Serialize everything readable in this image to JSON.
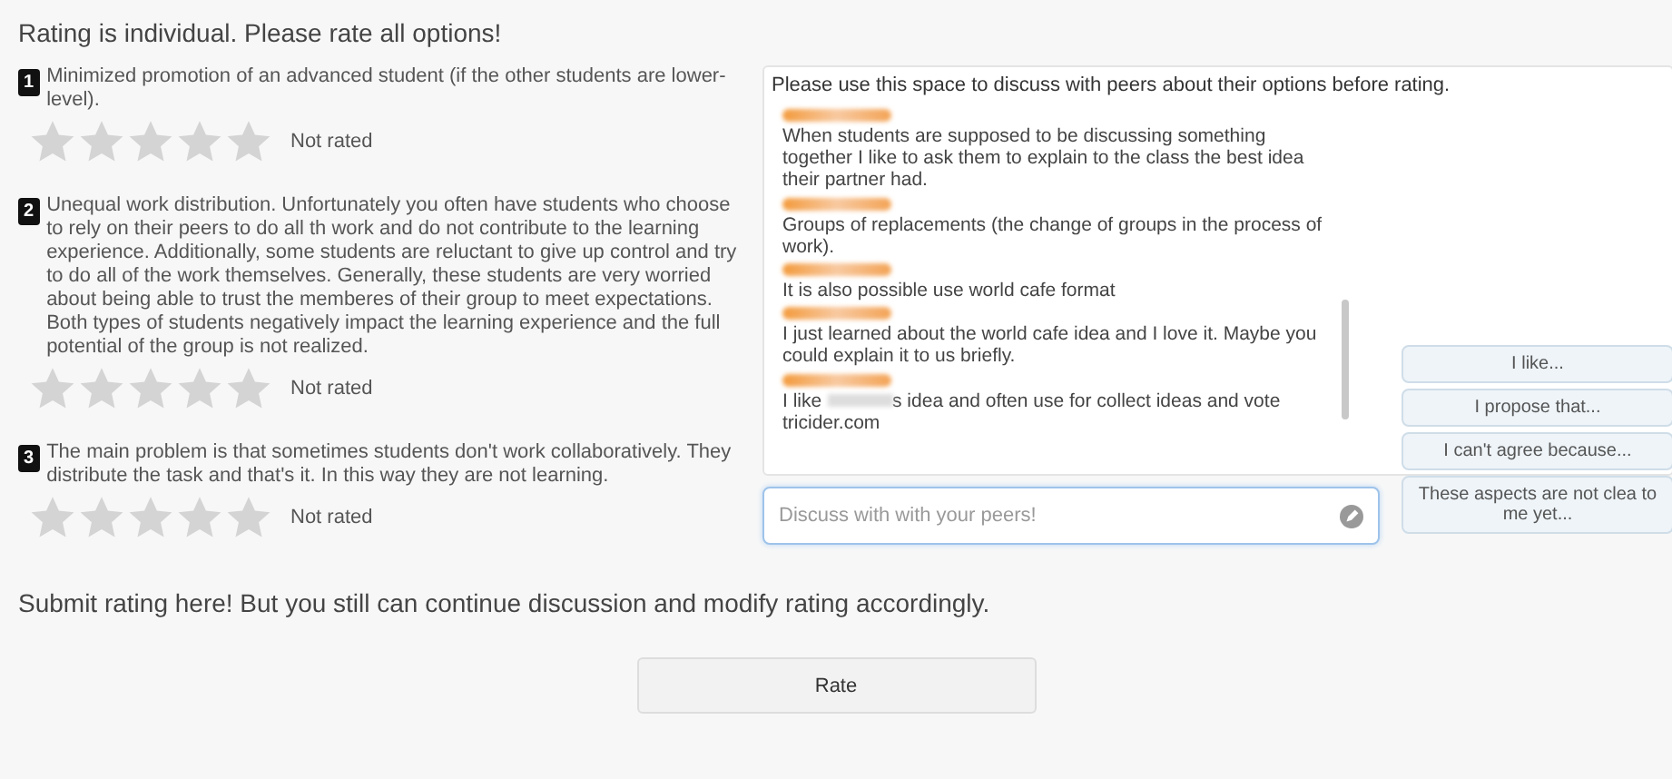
{
  "heading": "Rating is individual. Please rate all options!",
  "options": [
    {
      "number": "1",
      "text": "Minimized promotion of an advanced student (if the other students are lower-level).",
      "stars": 0,
      "status": "Not rated"
    },
    {
      "number": "2",
      "text": "Unequal work distribution. Unfortunately you often have students who choose to rely on their peers to do all th work and do not contribute to the learning experience. Additionally, some students are reluctant to give up control and try to do all of the work themselves. Generally, these students are very worried about being able to trust the memberes of their group to meet expectations. Both types of students negatively impact the learning experience and the full potential of the group is not realized.",
      "stars": 0,
      "status": "Not rated"
    },
    {
      "number": "3",
      "text": "The main problem is that sometimes students don't work collaboratively. They distribute the task and that's it. In this way they are not learning.",
      "stars": 0,
      "status": "Not rated"
    }
  ],
  "discussion": {
    "header": "Please use this space to discuss with peers about their options before rating.",
    "messages": [
      {
        "text": "When students are supposed to be discussing something together I like to ask them to explain to the class the best idea their partner had."
      },
      {
        "text": "Groups of replacements (the change of groups in the process of work)."
      },
      {
        "text": "It is also possible use world cafe format"
      },
      {
        "text": "I just learned about the world cafe idea and I love it. Maybe you could explain it to us briefly."
      },
      {
        "text": "I like",
        "text_after": "s idea and often use for collect ideas and vote tricider.com"
      }
    ],
    "input": {
      "placeholder": "Discuss with with your peers!"
    },
    "phrases": [
      "I like...",
      "I propose that...",
      "I can't agree because...",
      "These aspects are not clea to me yet..."
    ]
  },
  "submit_note": "Submit rating here! But you still can continue discussion and modify rating accordingly.",
  "rate_button": "Rate"
}
